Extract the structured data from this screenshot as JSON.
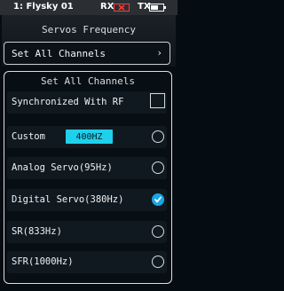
{
  "status": {
    "model": "1: Flysky  01",
    "rx_label": "RX",
    "tx_label": "TX",
    "battery_level": 0.6,
    "rx_signal_icon": "no-signal-icon",
    "accent_alert": "#ff3b3b"
  },
  "page": {
    "title": "Servos Frequency"
  },
  "set_all_row": {
    "label": "Set All Channels",
    "chevron": "›"
  },
  "panel": {
    "title": "Set All Channels",
    "sync_label": "Synchronized With RF",
    "custom_label": "Custom",
    "custom_value": "400HZ",
    "options": [
      {
        "label": "Analog Servo(95Hz)",
        "checked": false
      },
      {
        "label": "Digital Servo(380Hz)",
        "checked": true
      },
      {
        "label": "SR(833Hz)",
        "checked": false
      },
      {
        "label": "SFR(1000Hz)",
        "checked": false
      }
    ]
  },
  "colors": {
    "accent": "#18a7e6",
    "badge": "#1fd0ec"
  }
}
